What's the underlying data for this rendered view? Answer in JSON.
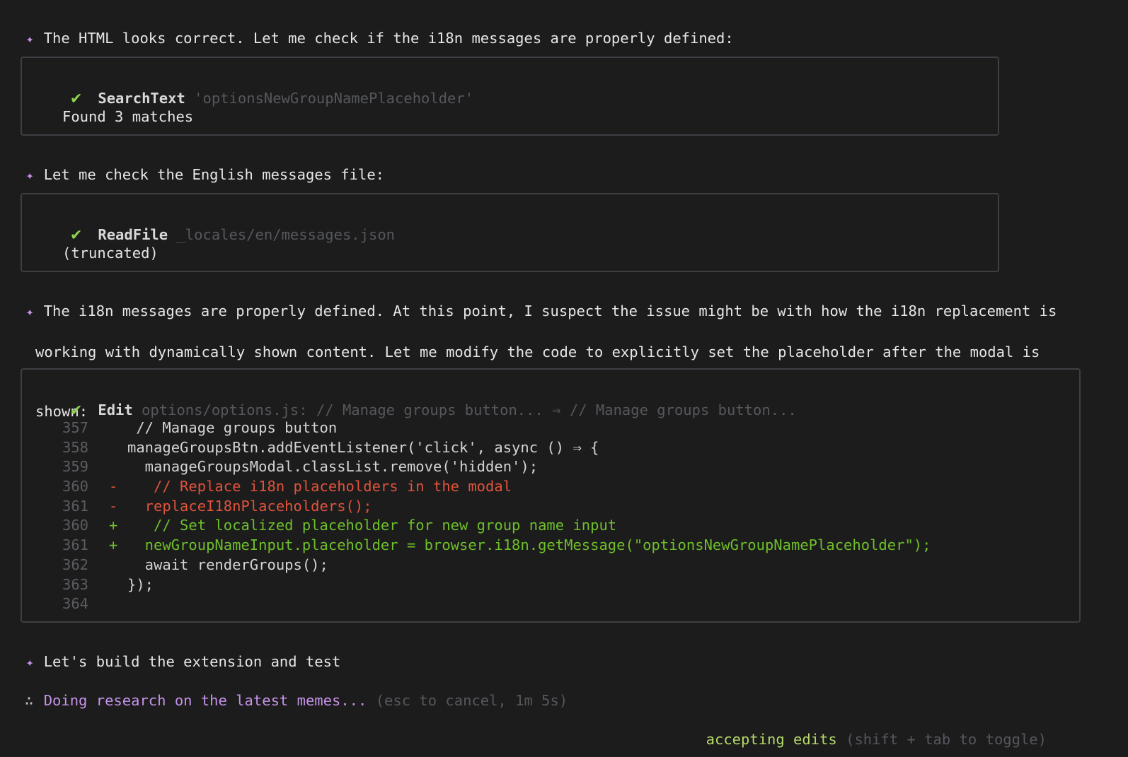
{
  "messages": [
    {
      "text": "The HTML looks correct. Let me check if the i18n messages are properly defined:"
    },
    {
      "text": "Let me check the English messages file:"
    },
    {
      "lines": [
        "The i18n messages are properly defined. At this point, I suspect the issue might be with how the i18n replacement is",
        "working with dynamically shown content. Let me modify the code to explicitly set the placeholder after the modal is",
        "shown:"
      ]
    },
    {
      "text": "Let's build the extension and test"
    }
  ],
  "tool_calls": [
    {
      "name": "SearchText",
      "arg": "'optionsNewGroupNamePlaceholder'",
      "result": "Found 3 matches"
    },
    {
      "name": "ReadFile",
      "arg": "_locales/en/messages.json",
      "result": "(truncated)"
    },
    {
      "name": "Edit",
      "arg": "options/options.js: // Manage groups button... ⇒ // Manage groups button..."
    }
  ],
  "diff": [
    {
      "ln": "357",
      "mark": "",
      "type": "ctx",
      "code": " // Manage groups button"
    },
    {
      "ln": "358",
      "mark": "",
      "type": "ctx",
      "code": "manageGroupsBtn.addEventListener('click', async () ⇒ {"
    },
    {
      "ln": "359",
      "mark": "",
      "type": "ctx",
      "code": "  manageGroupsModal.classList.remove('hidden');"
    },
    {
      "ln": "360",
      "mark": "-",
      "type": "del",
      "code": "   // Replace i18n placeholders in the modal"
    },
    {
      "ln": "361",
      "mark": "-",
      "type": "del",
      "code": "  replaceI18nPlaceholders();"
    },
    {
      "ln": "360",
      "mark": "+",
      "type": "add",
      "code": "   // Set localized placeholder for new group name input"
    },
    {
      "ln": "361",
      "mark": "+",
      "type": "add",
      "code": "  newGroupNameInput.placeholder = browser.i18n.getMessage(\"optionsNewGroupNamePlaceholder\");"
    },
    {
      "ln": "362",
      "mark": "",
      "type": "ctx",
      "code": "  await renderGroups();"
    },
    {
      "ln": "363",
      "mark": "",
      "type": "ctx",
      "code": "});"
    },
    {
      "ln": "364",
      "mark": "",
      "type": "ctx",
      "code": ""
    }
  ],
  "status": {
    "spinner": "∴",
    "activity": "Doing research on the latest memes...",
    "hint": "(esc to cancel, 1m 5s)"
  },
  "footer": {
    "mode": "accepting edits",
    "hint": "(shift + tab to toggle)"
  },
  "colors": {
    "background": "#1c1c1c",
    "star": "#c792ea",
    "check": "#8fd14f",
    "deleted": "#e0533c",
    "added": "#6fbf2a",
    "mode": "#b5d96a"
  },
  "icons": {
    "bullet": "sparkle-icon",
    "success": "check-icon"
  }
}
